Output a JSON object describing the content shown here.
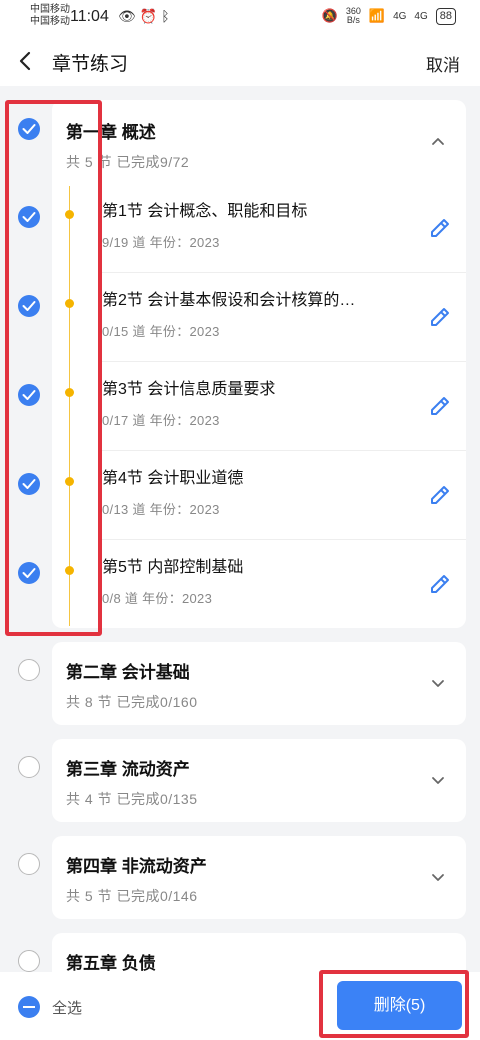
{
  "status_bar": {
    "carrier_1": "中国移动",
    "carrier_2": "中国移动",
    "time": "11:04",
    "speed_value": "360",
    "speed_unit": "B/s",
    "network_1": "4G",
    "network_2": "4G",
    "battery": "88"
  },
  "header": {
    "title": "章节练习",
    "cancel_label": "取消"
  },
  "chapters": [
    {
      "title": "第一章 概述",
      "meta": "共 5 节   已完成9/72",
      "checked": true,
      "expanded": true,
      "sections": [
        {
          "title": "第1节  会计概念、职能和目标",
          "meta": "9/19 道    年份：2023",
          "checked": true
        },
        {
          "title": "第2节  会计基本假设和会计核算的…",
          "meta": "0/15 道    年份：2023",
          "checked": true
        },
        {
          "title": "第3节  会计信息质量要求",
          "meta": "0/17 道    年份：2023",
          "checked": true
        },
        {
          "title": "第4节  会计职业道德",
          "meta": "0/13 道    年份：2023",
          "checked": true
        },
        {
          "title": "第5节  内部控制基础",
          "meta": "0/8 道    年份：2023",
          "checked": true
        }
      ]
    },
    {
      "title": "第二章 会计基础",
      "meta": "共 8 节   已完成0/160",
      "checked": false,
      "expanded": false
    },
    {
      "title": "第三章 流动资产",
      "meta": "共 4 节   已完成0/135",
      "checked": false,
      "expanded": false
    },
    {
      "title": "第四章 非流动资产",
      "meta": "共 5 节   已完成0/146",
      "checked": false,
      "expanded": false
    },
    {
      "title": "第五章 负债",
      "checked": false,
      "expanded": false
    }
  ],
  "bottom_bar": {
    "select_all_label": "全选",
    "delete_label": "删除(5)"
  },
  "colors": {
    "accent": "#3b7ff0",
    "timeline_dot": "#f5b400",
    "highlight": "#e2323f"
  }
}
